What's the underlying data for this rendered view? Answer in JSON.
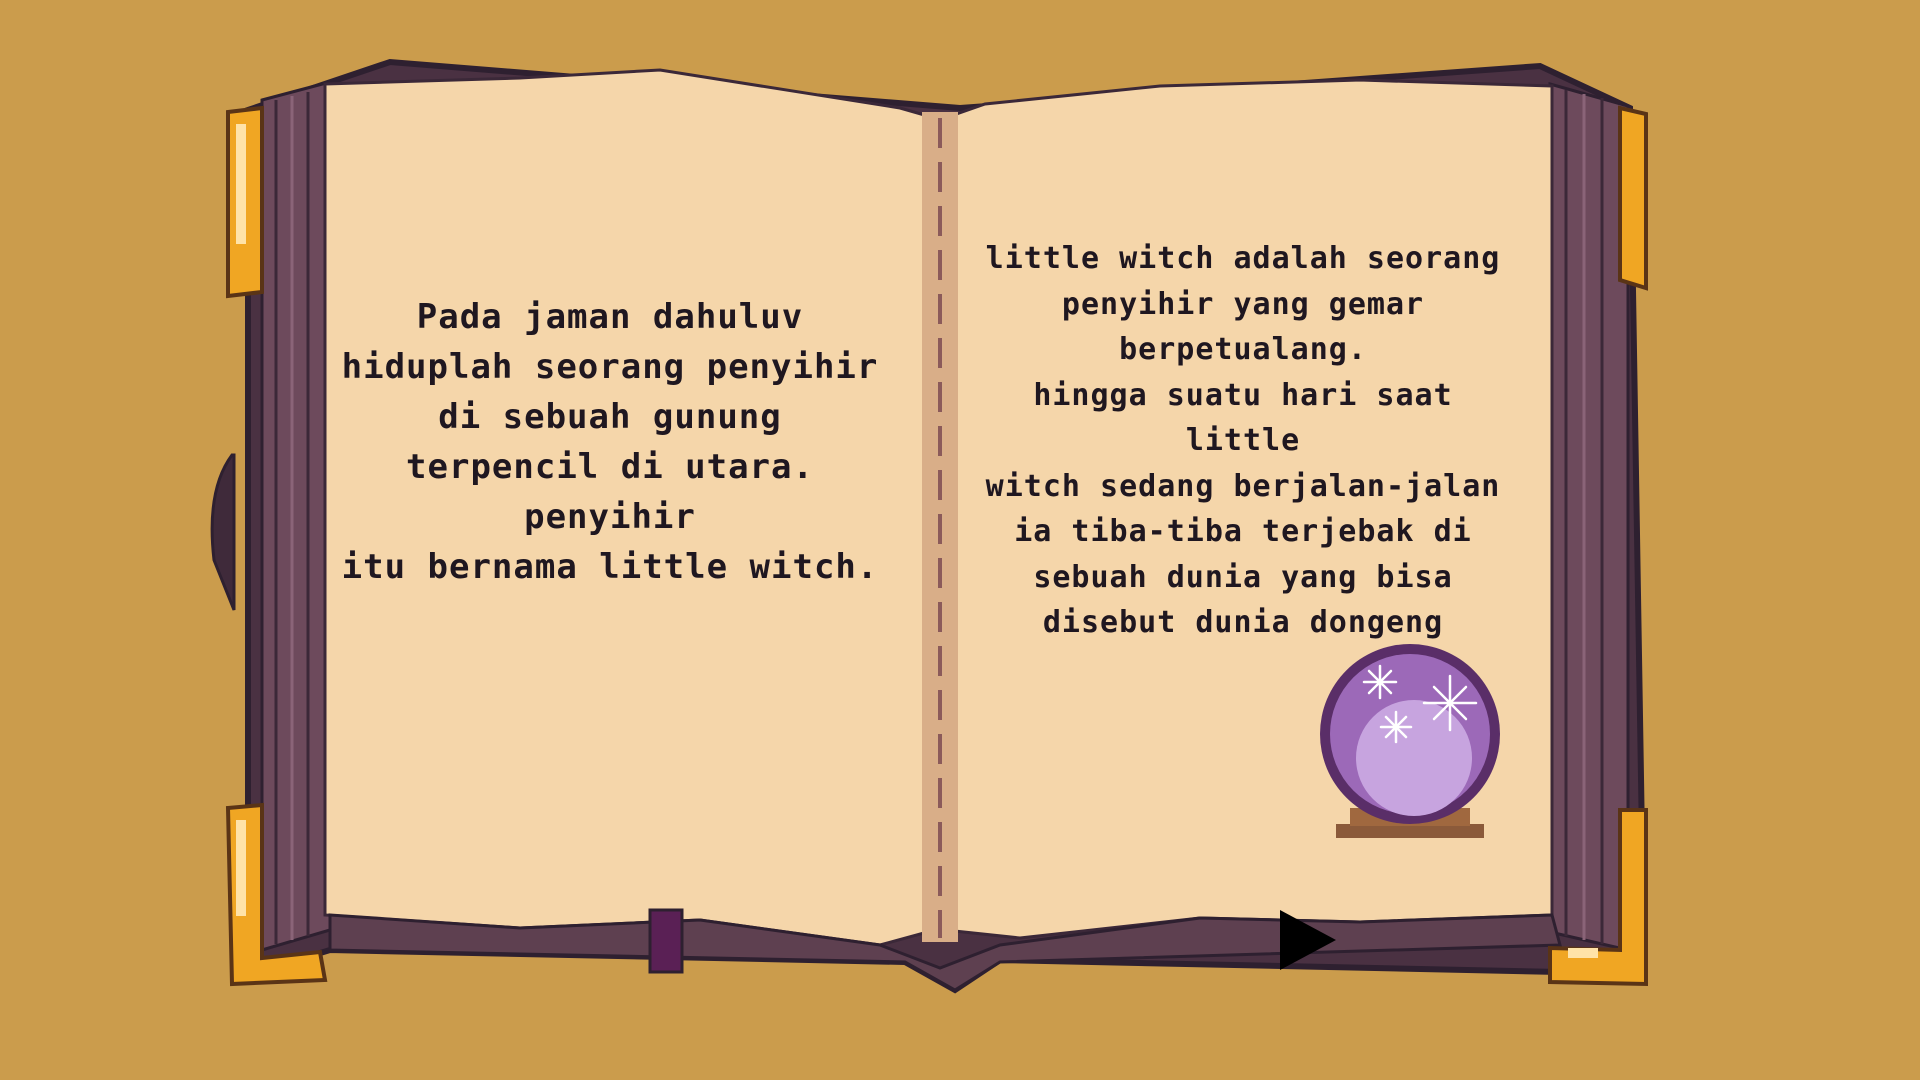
{
  "story": {
    "left_page_text": "Pada jaman dahuluv\nhiduplah seorang penyihir\ndi sebuah gunung\nterpencil di utara. penyihir\nitu bernama little witch.",
    "right_page_text": "little witch adalah seorang\npenyihir yang gemar\nberpetualang.\nhingga suatu hari saat little\nwitch sedang berjalan-jalan\nia tiba-tiba terjebak di\nsebuah dunia yang bisa\ndisebut dunia dongeng"
  },
  "icons": {
    "next": "play-triangle-icon",
    "crystal_ball": "crystal-ball-icon"
  },
  "colors": {
    "background": "#CB9C4C",
    "page": "#F5D6AA",
    "cover": "#5A3D4F",
    "cover_dark": "#2E2030",
    "gold": "#F0A623",
    "text": "#1f1720",
    "crystal": "#9C69B8"
  }
}
